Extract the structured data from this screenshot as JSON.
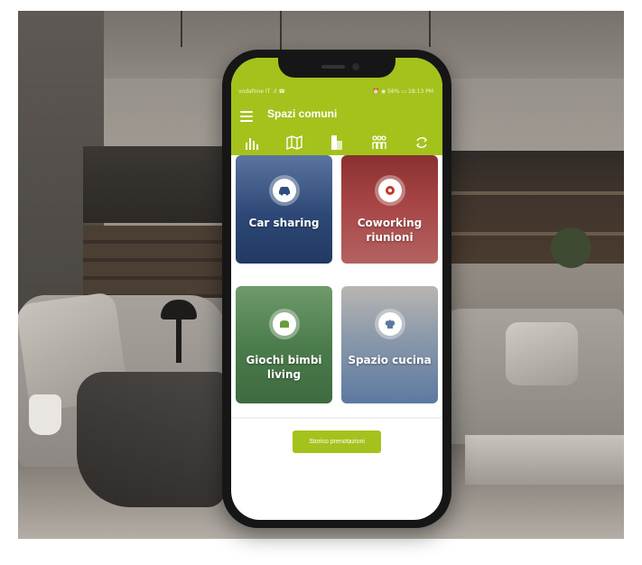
{
  "app": {
    "title": "Spazi comuni",
    "accent_color": "#a4c21c"
  },
  "status_bar": {
    "left": "vodafone IT  .ıl ☎",
    "right": "⏰ ◉ 56% ▭ 18:13 PM"
  },
  "nav": {
    "menu_icon": "hamburger-menu-icon",
    "tabs": [
      {
        "icon": "bar-chart-icon"
      },
      {
        "icon": "map-icon"
      },
      {
        "icon": "building-icon"
      },
      {
        "icon": "people-icon"
      },
      {
        "icon": "recycle-icon"
      }
    ]
  },
  "tiles": [
    {
      "label": "Car sharing",
      "icon": "car-icon",
      "color": "#2f4e80"
    },
    {
      "label": "Coworking riunioni",
      "icon": "gear-icon",
      "color": "#a84545"
    },
    {
      "label": "Giochi bimbi living",
      "icon": "armchair-icon",
      "color": "#4a7a4a"
    },
    {
      "label": "Spazio cucina",
      "icon": "chef-hat-icon",
      "color": "#5c7aa0"
    }
  ],
  "history_button": {
    "label": "Storico prenotazioni"
  }
}
